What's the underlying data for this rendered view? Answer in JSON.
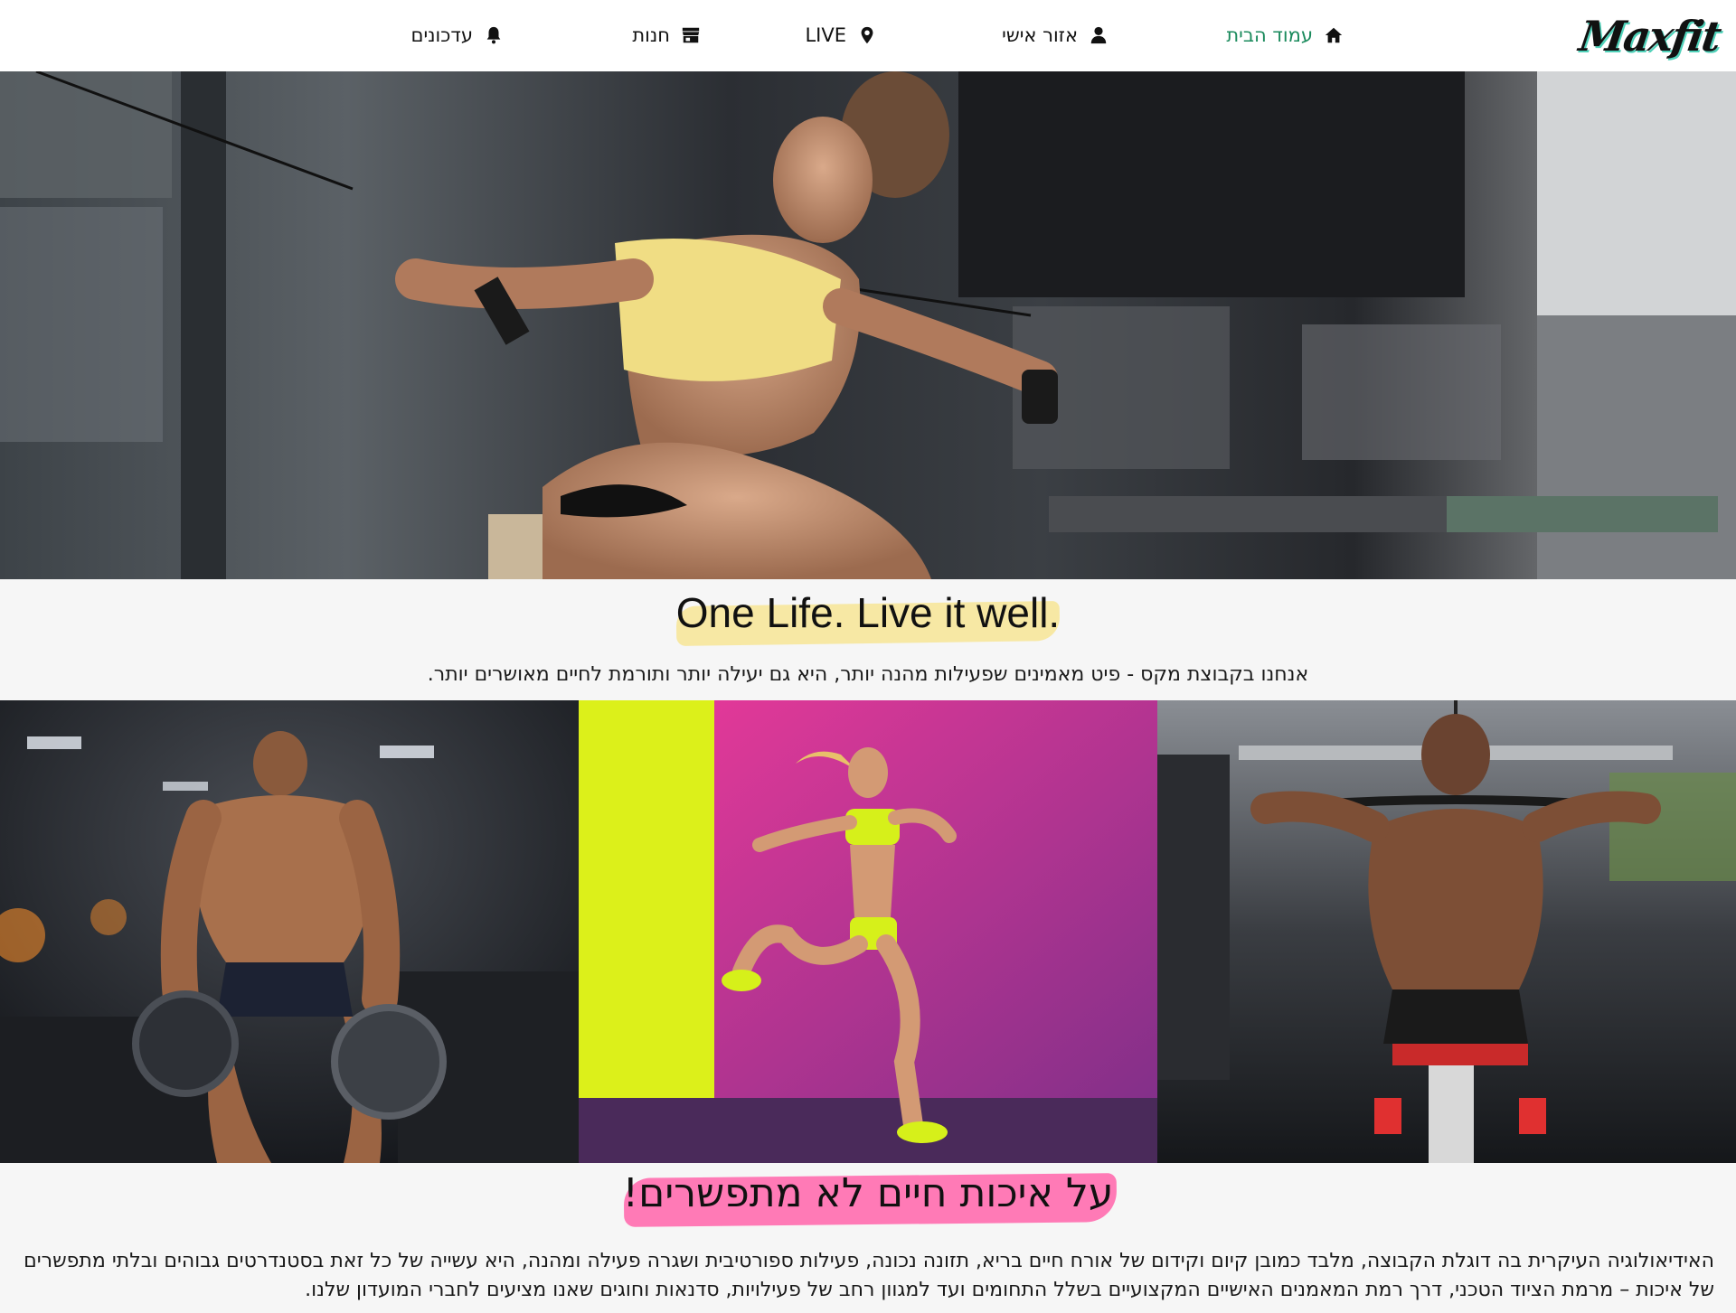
{
  "brand": {
    "logo_text": "Maxfit"
  },
  "nav": {
    "items": [
      {
        "id": "home",
        "label": "עמוד הבית",
        "icon": "home-icon",
        "active": true
      },
      {
        "id": "personal",
        "label": "אזור אישי",
        "icon": "user-icon",
        "active": false
      },
      {
        "id": "live",
        "label": "LIVE",
        "icon": "map-marker-icon",
        "active": false
      },
      {
        "id": "shop",
        "label": "חנות",
        "icon": "store-icon",
        "active": false
      },
      {
        "id": "updates",
        "label": "עדכונים",
        "icon": "bell-icon",
        "active": false
      }
    ]
  },
  "hero": {
    "image": "woman-cable-crossover-gym-photo"
  },
  "slogan": "One Life. Live it well.",
  "intro": "אנחנו בקבוצת מקס - פיט מאמינים שפעילות מהנה יותר, היא גם יעילה יותר ותורמת לחיים מאושרים יותר.",
  "gallery": [
    {
      "image": "bodybuilder-with-weight-plates-photo"
    },
    {
      "image": "woman-jumping-neon-background-photo"
    },
    {
      "image": "man-lat-pulldown-back-photo"
    }
  ],
  "section2": {
    "title": "על איכות חיים לא מתפשרים!",
    "body": "האידיאולוגיה העיקרית בה דוגלת הקבוצה, מלבד כמובן קיום וקידום של אורח חיים בריא, תזונה נכונה, פעילות ספורטיבית ושגרה פעילה ומהנה, היא עשייה של כל זאת בסטנדרטים גבוהים ובלתי מתפשרים של איכות – מרמת הציוד הטכני, דרך רמת המאמנים האישיים המקצועיים בשלל התחומים ועד למגוון רחב של פעילויות, סדנאות וחוגים שאנו מציעים לחברי המועדון שלנו."
  },
  "colors": {
    "nav_active": "#1a8a5c",
    "slogan_highlight": "#f7e8a4",
    "title_highlight": "#ff7ab6",
    "page_bg": "#f6f6f6"
  }
}
